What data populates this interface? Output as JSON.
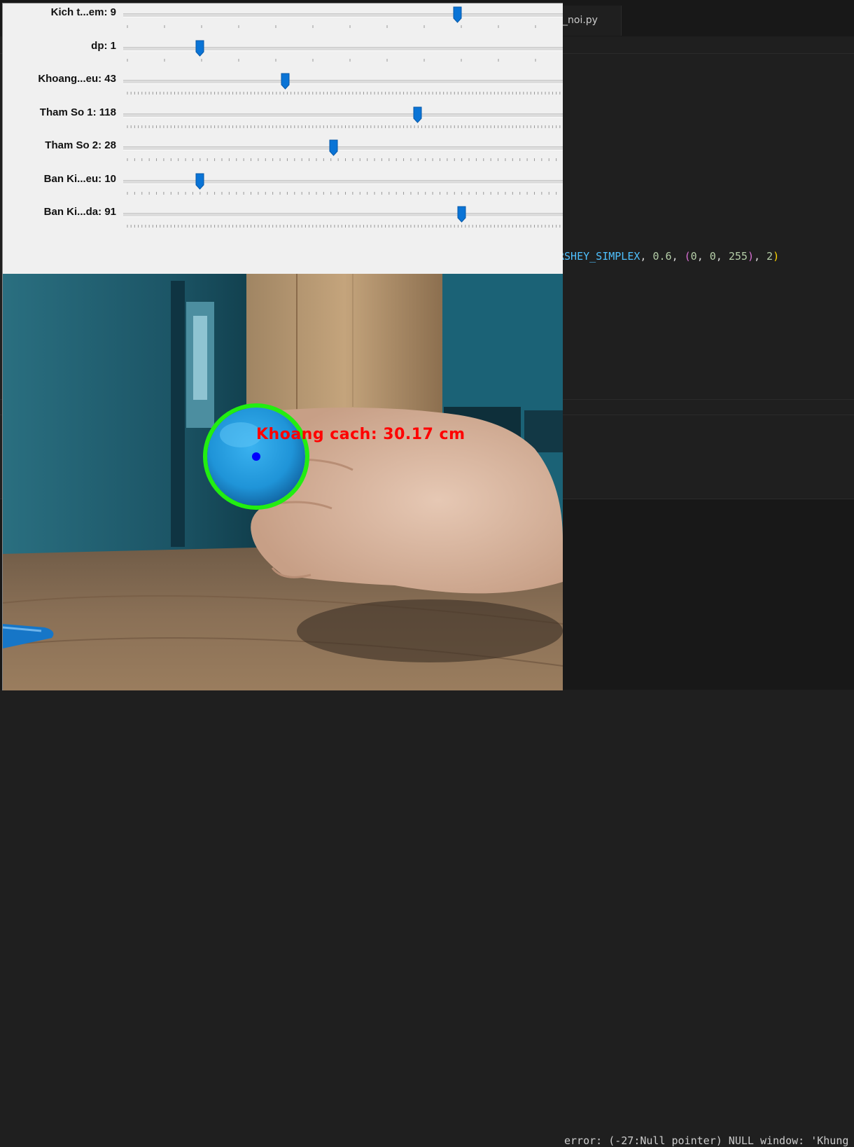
{
  "editor": {
    "tab_label": "_noi.py",
    "code_line": {
      "const": "RSHEY_SIMPLEX",
      "sep1": ", ",
      "scale": "0.6",
      "sep2": ", ",
      "open_outer": "(",
      "open_inner": "(",
      "b": "0",
      "g": "0",
      "r": "255",
      "close_inner": ")",
      "thickness": "2",
      "close_outer": ")"
    },
    "terminal_line": "error: (-27:Null pointer) NULL window: 'Khung"
  },
  "trackbars": [
    {
      "label": "Kich t...em: 9",
      "position_fraction": 0.758
    },
    {
      "label": "dp: 1",
      "position_fraction": 0.175
    },
    {
      "label": "Khoang...eu: 43",
      "position_fraction": 0.368
    },
    {
      "label": "Tham So 1: 118",
      "position_fraction": 0.668
    },
    {
      "label": "Tham So 2: 28",
      "position_fraction": 0.478
    },
    {
      "label": "Ban Ki...eu: 10",
      "position_fraction": 0.175
    },
    {
      "label": "Ban Ki...da: 91",
      "position_fraction": 0.768
    }
  ],
  "camera": {
    "overlay_text": "Khoang cach: 30.17 cm",
    "circle_color": "#22ee11",
    "center_dot_color": "#0000ff",
    "text_color": "#ff0000"
  },
  "colors": {
    "thumb": "#0a74d6",
    "editor_bg": "#1f1f1f"
  }
}
